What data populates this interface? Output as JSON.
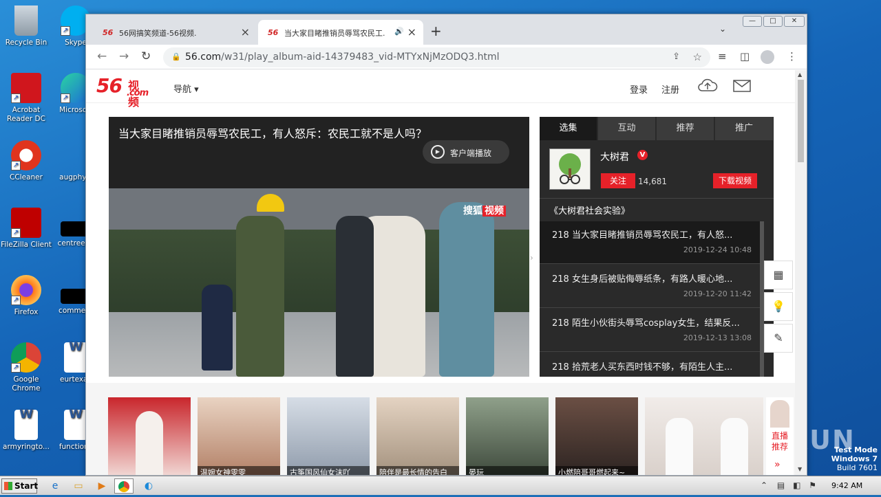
{
  "desktop": {
    "icons": [
      {
        "label": "Recycle Bin",
        "name": "recycle-bin"
      },
      {
        "label": "Skype",
        "name": "skype"
      },
      {
        "label": "Acrobat Reader DC",
        "name": "acrobat"
      },
      {
        "label": "Microsoft",
        "name": "edge"
      },
      {
        "label": "CCleaner",
        "name": "ccleaner"
      },
      {
        "label": "augphysi",
        "name": "augphysi"
      },
      {
        "label": "FileZilla Client",
        "name": "filezilla"
      },
      {
        "label": "centreeve",
        "name": "centreeve"
      },
      {
        "label": "Firefox",
        "name": "firefox"
      },
      {
        "label": "comment",
        "name": "comment"
      },
      {
        "label": "Google Chrome",
        "name": "chrome"
      },
      {
        "label": "eurtexas",
        "name": "eurtexas"
      },
      {
        "label": "armyringto...",
        "name": "armyringto"
      },
      {
        "label": "functions",
        "name": "functions"
      }
    ],
    "watermark": {
      "line1": "Test Mode",
      "line2": "Windows 7",
      "line3": "Build 7601"
    },
    "anyrun": "ANY.RUN"
  },
  "browser": {
    "tabs": [
      {
        "title": "56网搞笑频道-56视频.",
        "favicon": "56"
      },
      {
        "title": "当大家目睹推销员辱骂农民工.",
        "favicon": "56"
      }
    ],
    "url_host": "56.com",
    "url_path": "/w31/play_album-aid-14379483_vid-MTYxNjMzODQ3.html",
    "win_controls": {
      "minimize": "—",
      "maximize": "□",
      "close": "✕"
    }
  },
  "site": {
    "logo_num": "56",
    "logo_cn": "视频",
    "logo_com": ".com",
    "nav_label": "导航 ▾",
    "login": "登录",
    "register": "注册"
  },
  "player": {
    "title": "当大家目睹推销员辱骂农民工，有人怒斥：农民工就不是人吗？",
    "client_play": "客户端播放",
    "watermark_text": "搜狐",
    "watermark_badge": "视频"
  },
  "panel": {
    "tabs": [
      "选集",
      "互动",
      "推荐",
      "推广"
    ],
    "author": "大树君",
    "verified": "V",
    "follow": "关注",
    "fans": "14,681",
    "download": "下载视频",
    "album": "《大树君社会实验》",
    "episodes": [
      {
        "title": "218  当大家目睹推销员辱骂农民工，有人怒...",
        "date": "2019-12-24 10:48"
      },
      {
        "title": "218  女生身后被贴侮辱纸条，有路人暖心地...",
        "date": "2019-12-20 11:42"
      },
      {
        "title": "218  陌生小伙街头辱骂cosplay女生，结果反...",
        "date": "2019-12-13 13:08"
      },
      {
        "title": "218  拾荒老人买东西时钱不够，有陌生人主...",
        "date": ""
      }
    ]
  },
  "thumbnails": [
    {
      "caption": "",
      "color": "#c9262c"
    },
    {
      "caption": "温婉女神雯雯",
      "color": "#d9b79a"
    },
    {
      "caption": "古筝国风仙女沫吖",
      "color": "#a8b3c4"
    },
    {
      "caption": "陪伴是最长情的告白",
      "color": "#c8b3a0"
    },
    {
      "caption": "晏玩",
      "color": "#5d6a5a"
    },
    {
      "caption": "小燃陪哥哥燃起来~",
      "color": "#4a3a35"
    },
    {
      "caption": "",
      "color": "#e8e3e0"
    }
  ],
  "recommend_side": {
    "text": "直播推荐",
    "chevron": "»"
  },
  "taskbar": {
    "start": "Start",
    "time": "9:42 AM"
  }
}
